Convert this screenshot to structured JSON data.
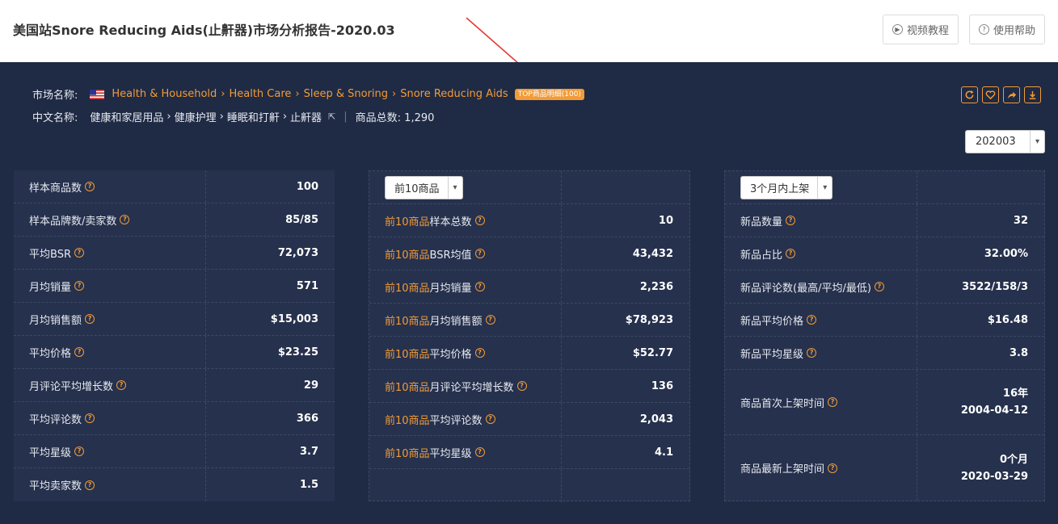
{
  "header": {
    "title": "美国站Snore Reducing Aids(止鼾器)市场分析报告-2020.03",
    "video_btn": "视频教程",
    "help_btn": "使用帮助"
  },
  "market": {
    "label": "市场名称:",
    "crumbs": [
      "Health & Household",
      "Health Care",
      "Sleep & Snoring",
      "Snore Reducing Aids"
    ],
    "badge": "TOP商品明细(100)",
    "cn_label": "中文名称:",
    "cn_crumbs": [
      "健康和家居用品",
      "健康护理",
      "睡眠和打鼾",
      "止鼾器"
    ],
    "count_label": "商品总数: 1,290"
  },
  "month": {
    "value": "202003"
  },
  "colors": {
    "accent": "#f29b38",
    "panel": "#1f2a44",
    "card": "#26314d"
  },
  "table1": {
    "rows": [
      {
        "label": "样本商品数",
        "value": "100"
      },
      {
        "label": "样本品牌数/卖家数",
        "value": "85/85"
      },
      {
        "label": "平均BSR",
        "value": "72,073"
      },
      {
        "label": "月均销量",
        "value": "571"
      },
      {
        "label": "月均销售额",
        "value": "$15,003"
      },
      {
        "label": "平均价格",
        "value": "$23.25"
      },
      {
        "label": "月评论平均增长数",
        "value": "29"
      },
      {
        "label": "平均评论数",
        "value": "366"
      },
      {
        "label": "平均星级",
        "value": "3.7"
      },
      {
        "label": "平均卖家数",
        "value": "1.5"
      }
    ]
  },
  "table2": {
    "select": "前10商品",
    "prefix": "前10商品",
    "rows": [
      {
        "label": "样本总数",
        "value": "10"
      },
      {
        "label": "BSR均值",
        "value": "43,432"
      },
      {
        "label": "月均销量",
        "value": "2,236"
      },
      {
        "label": "月均销售额",
        "value": "$78,923"
      },
      {
        "label": "平均价格",
        "value": "$52.77"
      },
      {
        "label": "月评论平均增长数",
        "value": "136"
      },
      {
        "label": "平均评论数",
        "value": "2,043"
      },
      {
        "label": "平均星级",
        "value": "4.1"
      }
    ]
  },
  "table3": {
    "select": "3个月内上架",
    "rows": [
      {
        "label": "新品数量",
        "value": "32"
      },
      {
        "label": "新品占比",
        "value": "32.00%"
      },
      {
        "label": "新品评论数(最高/平均/最低)",
        "value": "3522/158/3"
      },
      {
        "label": "新品平均价格",
        "value": "$16.48"
      },
      {
        "label": "新品平均星级",
        "value": "3.8"
      }
    ],
    "first_listed": {
      "label": "商品首次上架时间",
      "line1": "16年",
      "line2": "2004-04-12"
    },
    "last_listed": {
      "label": "商品最新上架时间",
      "line1": "0个月",
      "line2": "2020-03-29"
    }
  }
}
